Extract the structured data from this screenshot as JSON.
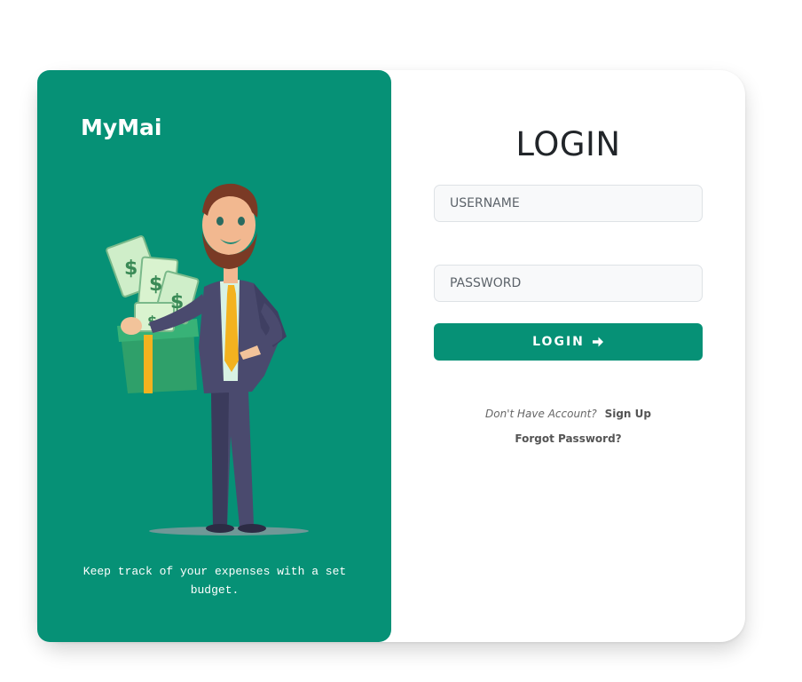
{
  "brand": {
    "name": "MyMai",
    "tagline": "Keep track of your expenses with a set budget."
  },
  "login": {
    "title": "LOGIN",
    "username_placeholder": "USERNAME",
    "password_placeholder": "PASSWORD",
    "button_label": "LOGIN",
    "signup_prompt": "Don't Have Account?",
    "signup_link": "Sign Up",
    "forgot_link": "Forgot Password?"
  },
  "colors": {
    "accent": "#069176",
    "background": "#ffffff",
    "field_bg": "#f8f9fa"
  },
  "icons": {
    "button_icon": "arrow-right-icon"
  },
  "illustration": "businessman-with-money-box"
}
